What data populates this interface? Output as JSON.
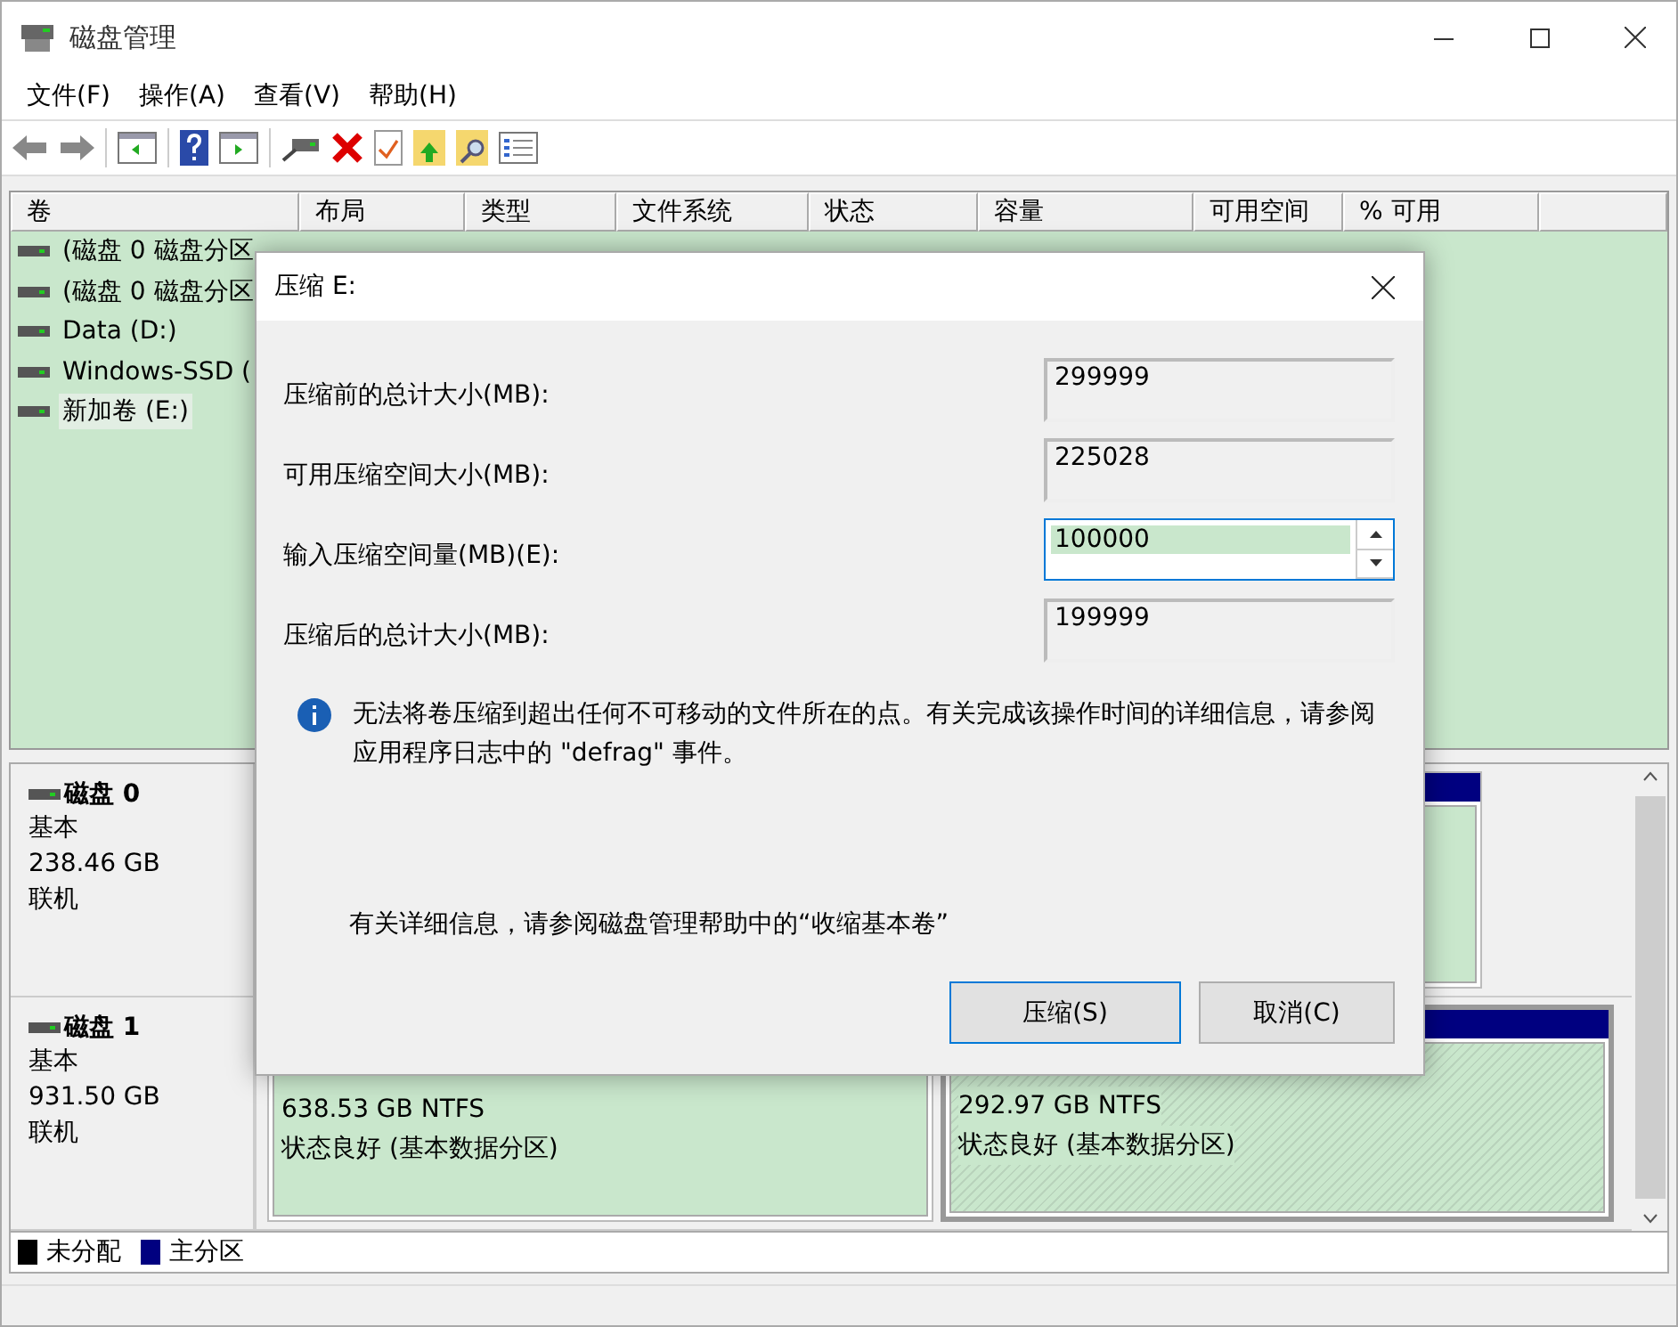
{
  "window": {
    "title": "磁盘管理"
  },
  "menu": [
    "文件(F)",
    "操作(A)",
    "查看(V)",
    "帮助(H)"
  ],
  "volume_table": {
    "columns": [
      "卷",
      "布局",
      "类型",
      "文件系统",
      "状态",
      "容量",
      "可用空间",
      "% 可用"
    ],
    "rows": [
      {
        "volume": "(磁盘 0 磁盘分区",
        "selected": false
      },
      {
        "volume": "(磁盘 0 磁盘分区",
        "selected": false
      },
      {
        "volume": "Data (D:)",
        "selected": false
      },
      {
        "volume": "Windows-SSD (",
        "selected": false
      },
      {
        "volume": "新加卷 (E:)",
        "selected": true
      }
    ]
  },
  "disks": [
    {
      "name": "磁盘 0",
      "type": "基本",
      "size": "238.46 GB",
      "status": "联机",
      "partitions": [
        {
          "selected": false
        }
      ]
    },
    {
      "name": "磁盘 1",
      "type": "基本",
      "size": "931.50 GB",
      "status": "联机",
      "partitions": [
        {
          "size": "638.53 GB NTFS",
          "status": "状态良好 (基本数据分区)",
          "selected": false
        },
        {
          "size": "292.97 GB NTFS",
          "status": "状态良好 (基本数据分区)",
          "selected": true
        }
      ]
    }
  ],
  "legend": [
    {
      "label": "未分配",
      "color": "#000000"
    },
    {
      "label": "主分区",
      "color": "#000080"
    }
  ],
  "dialog": {
    "title": "压缩 E:",
    "fields": [
      {
        "kind": "readonly",
        "label": "压缩前的总计大小(MB):",
        "value": "299999"
      },
      {
        "kind": "readonly",
        "label": "可用压缩空间大小(MB):",
        "value": "225028"
      },
      {
        "kind": "spin",
        "label": "输入压缩空间量(MB)(E):",
        "value": "100000",
        "text_selected": true
      },
      {
        "kind": "readonly",
        "label": "压缩后的总计大小(MB):",
        "value": "199999"
      }
    ],
    "info": "无法将卷压缩到超出任何不可移动的文件所在的点。有关完成该操作时间的详细信息，请参阅应用程序日志中的 \"defrag\" 事件。",
    "help": "有关详细信息，请参阅磁盘管理帮助中的“收缩基本卷”",
    "buttons": [
      {
        "label": "压缩(S)",
        "default": true
      },
      {
        "label": "取消(C)",
        "default": false
      }
    ]
  }
}
